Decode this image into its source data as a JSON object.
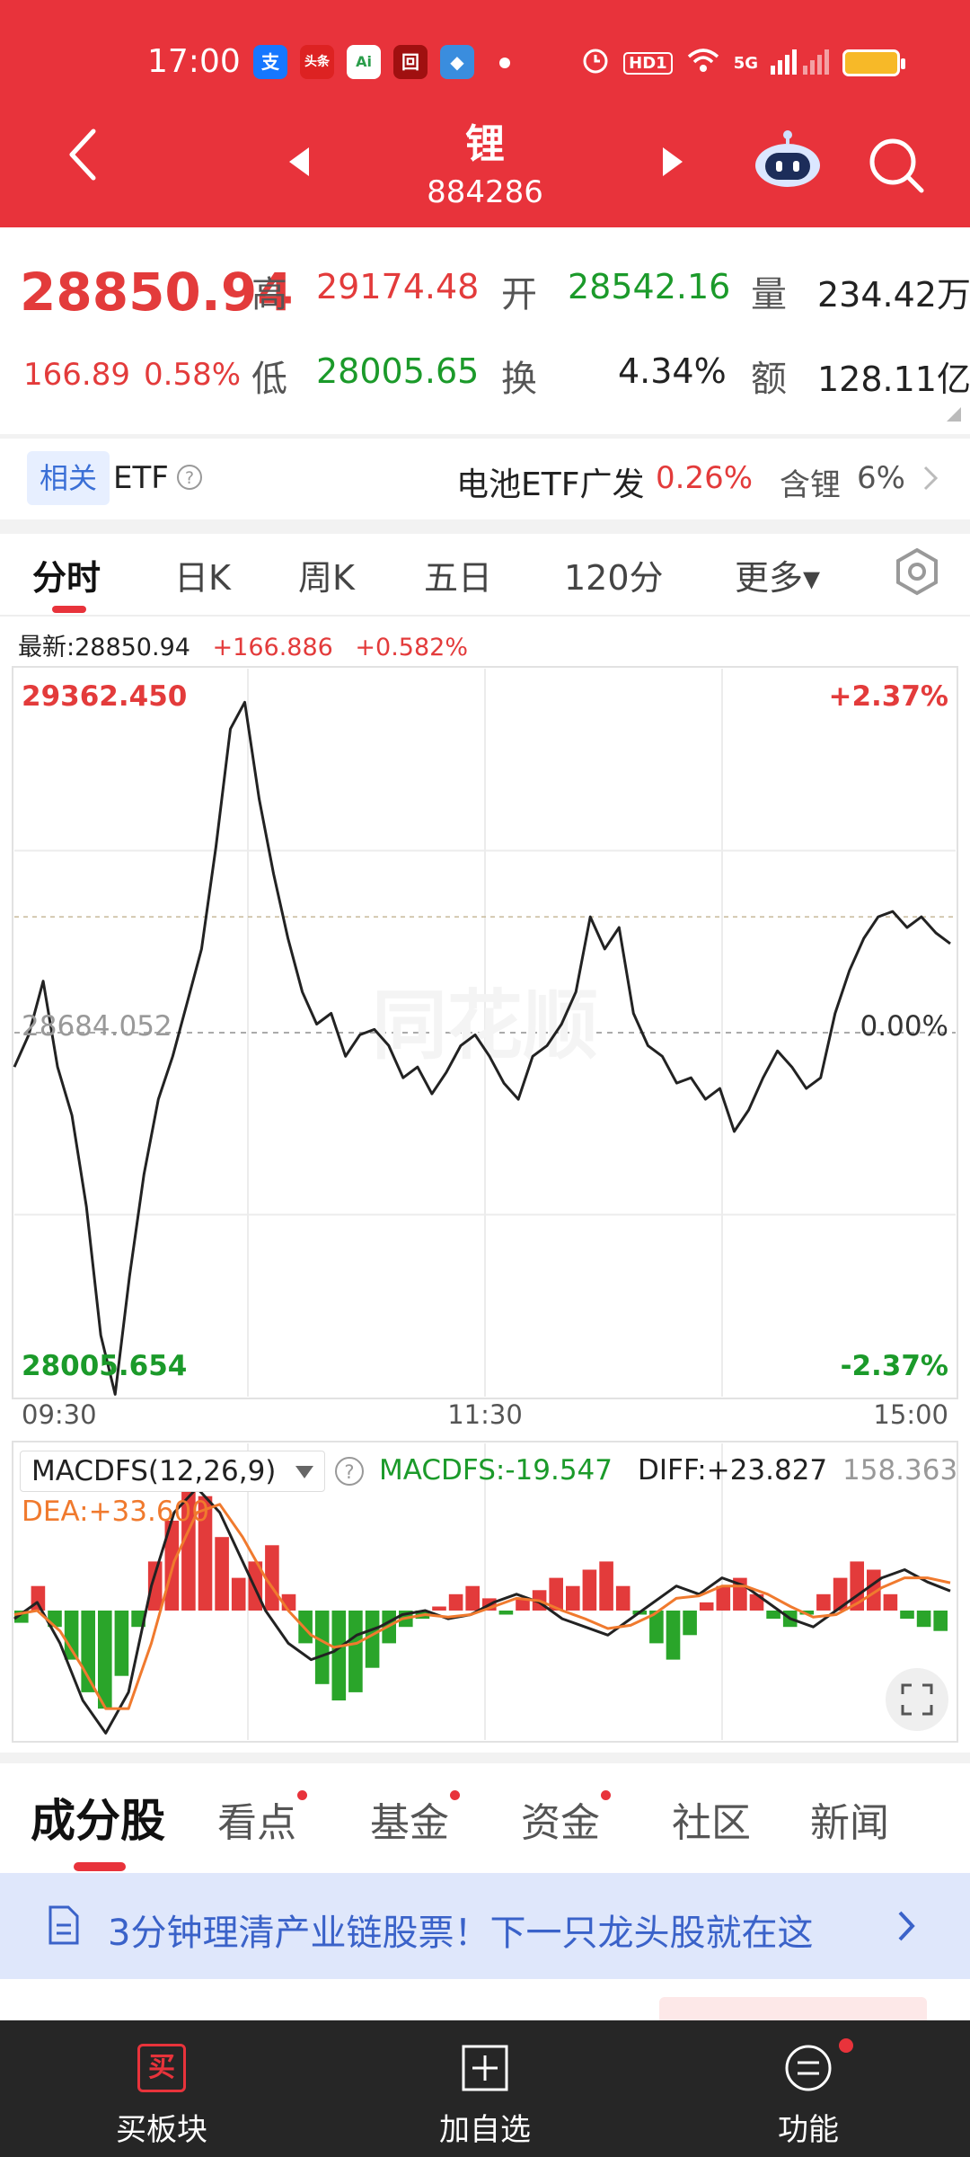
{
  "status_bar": {
    "time": "17:00",
    "network": "5G",
    "hd_badge": "HD1",
    "apps": [
      "支",
      "头条",
      "Ai",
      "回",
      "◆"
    ]
  },
  "header": {
    "title": "锂",
    "code": "884286",
    "icons": [
      "back-icon",
      "prev-icon",
      "next-icon",
      "robot-assistant-icon",
      "search-icon"
    ]
  },
  "quote": {
    "price": "28850.94",
    "change": "166.89",
    "change_pct": "0.58%",
    "high_label": "高",
    "high": "29174.48",
    "low_label": "低",
    "low": "28005.65",
    "open_label": "开",
    "open": "28542.16",
    "turnover_label": "换",
    "turnover": "4.34%",
    "volume_label": "量",
    "volume": "234.42万",
    "amount_label": "额",
    "amount": "128.11亿"
  },
  "etf": {
    "tag": "相关",
    "label": "ETF",
    "name": "电池ETF广发",
    "pct": "0.26%",
    "holding_label": "含锂",
    "holding": "6%"
  },
  "tabs": {
    "items": [
      "分时",
      "日K",
      "周K",
      "五日",
      "120分",
      "更多▾"
    ],
    "active": 0
  },
  "latest": {
    "label": "最新:28850.94",
    "change": "+166.886",
    "pct": "+0.582%"
  },
  "watermark": "同花顺",
  "chart_data": [
    {
      "type": "line",
      "title": "",
      "x_labels": [
        "09:30",
        "11:30",
        "15:00"
      ],
      "y_labels": {
        "top": "29362.450",
        "mid": "28684.052",
        "bottom": "28005.654",
        "top_pct": "+2.37%",
        "mid_pct": "0.00%",
        "bottom_pct": "-2.37%"
      },
      "ylim": [
        28005.654,
        29362.45
      ],
      "reference_value": 28684.052,
      "grid": true,
      "series": [
        {
          "values": [
            28620,
            28680,
            28780,
            28620,
            28530,
            28360,
            28120,
            28010,
            28230,
            28420,
            28560,
            28640,
            28740,
            28840,
            29030,
            29250,
            29300,
            29120,
            28980,
            28860,
            28760,
            28700,
            28720,
            28640,
            28680,
            28690,
            28660,
            28600,
            28620,
            28570,
            28610,
            28660,
            28680,
            28640,
            28590,
            28560,
            28640,
            28660,
            28700,
            28760,
            28900,
            28840,
            28880,
            28720,
            28660,
            28640,
            28590,
            28600,
            28560,
            28580,
            28500,
            28540,
            28600,
            28650,
            28620,
            28580,
            28600,
            28720,
            28800,
            28860,
            28900,
            28910,
            28880,
            28900,
            28870,
            28850
          ]
        }
      ]
    },
    {
      "type": "bar",
      "title": "MACDFS(12,26,9)",
      "indicator": "MACDFS(12,26,9)",
      "macdfs": "MACDFS:-19.547",
      "diff": "DIFF:+23.827",
      "dea": "DEA:+33.600",
      "ymax_label": "158.363",
      "ylim": [
        -158.363,
        158.363
      ],
      "histogram": [
        -15,
        30,
        -20,
        -60,
        -100,
        -120,
        -80,
        -20,
        60,
        110,
        150,
        140,
        90,
        40,
        60,
        80,
        20,
        -40,
        -90,
        -110,
        -100,
        -70,
        -40,
        -20,
        -10,
        5,
        20,
        30,
        15,
        -5,
        15,
        25,
        40,
        30,
        50,
        60,
        30,
        -5,
        -40,
        -60,
        -30,
        10,
        30,
        40,
        20,
        -10,
        -20,
        -5,
        20,
        40,
        60,
        50,
        20,
        -10,
        -20,
        -25
      ],
      "series": [
        {
          "name": "DIFF",
          "color": "#222222",
          "values": [
            -10,
            10,
            -40,
            -110,
            -150,
            -100,
            30,
            120,
            150,
            120,
            60,
            0,
            -40,
            -60,
            -50,
            -30,
            -20,
            -5,
            0,
            -10,
            -5,
            10,
            20,
            10,
            -10,
            -20,
            -30,
            -10,
            10,
            30,
            20,
            40,
            30,
            10,
            -10,
            -20,
            0,
            20,
            40,
            50,
            35,
            24
          ]
        },
        {
          "name": "DEA",
          "color": "#f07a2e",
          "values": [
            -5,
            0,
            -25,
            -70,
            -120,
            -120,
            -40,
            60,
            120,
            130,
            90,
            40,
            0,
            -30,
            -45,
            -40,
            -25,
            -10,
            -5,
            -8,
            -5,
            5,
            15,
            12,
            0,
            -10,
            -22,
            -18,
            -5,
            15,
            18,
            30,
            30,
            20,
            5,
            -8,
            -5,
            10,
            28,
            40,
            40,
            34
          ]
        }
      ]
    }
  ],
  "macd_toolbar": {
    "selector": "MACDFS(12,26,9)"
  },
  "content_tabs": {
    "items": [
      "成分股",
      "看点",
      "基金",
      "资金",
      "社区",
      "新闻"
    ],
    "active": 0
  },
  "banner": {
    "text": "3分钟理清产业链股票！下一只龙头股就在这"
  },
  "bottom_nav": {
    "buy": "买板块",
    "add": "加自选",
    "func": "功能",
    "buy_icon_text": "买"
  },
  "colors": {
    "header_bg": "#e8333b",
    "up": "#e33b3b",
    "down": "#1b9a2a",
    "dea": "#f07a2e"
  }
}
